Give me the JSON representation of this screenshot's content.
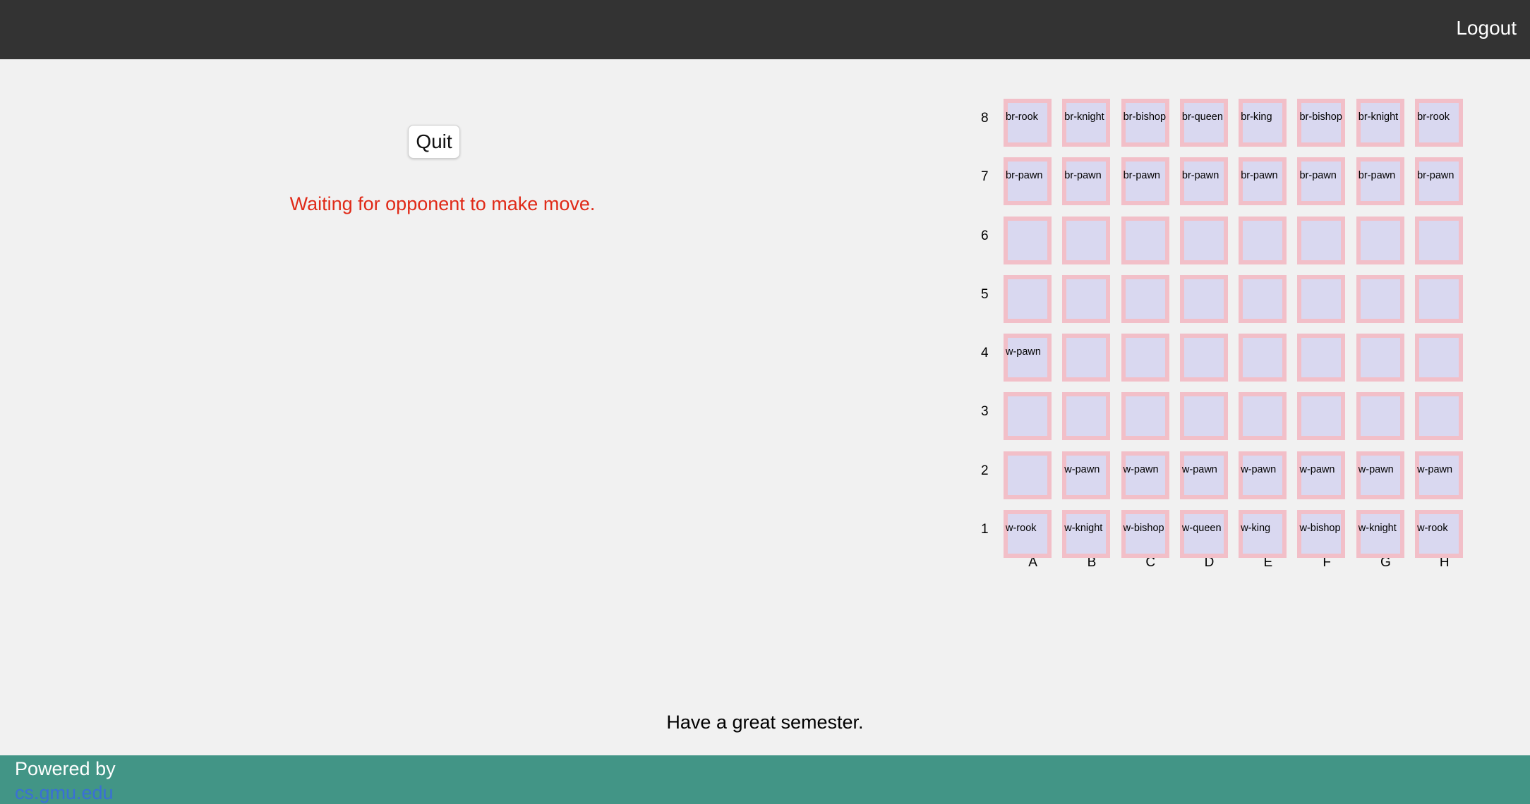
{
  "header": {
    "logout_label": "Logout"
  },
  "game": {
    "quit_label": "Quit",
    "status_text": "Waiting for opponent to make move."
  },
  "board": {
    "files": [
      "A",
      "B",
      "C",
      "D",
      "E",
      "F",
      "G",
      "H"
    ],
    "rows": [
      {
        "rank": "8",
        "squares": [
          "br-rook",
          "br-knight",
          "br-bishop",
          "br-queen",
          "br-king",
          "br-bishop",
          "br-knight",
          "br-rook"
        ]
      },
      {
        "rank": "7",
        "squares": [
          "br-pawn",
          "br-pawn",
          "br-pawn",
          "br-pawn",
          "br-pawn",
          "br-pawn",
          "br-pawn",
          "br-pawn"
        ]
      },
      {
        "rank": "6",
        "squares": [
          "",
          "",
          "",
          "",
          "",
          "",
          "",
          ""
        ]
      },
      {
        "rank": "5",
        "squares": [
          "",
          "",
          "",
          "",
          "",
          "",
          "",
          ""
        ]
      },
      {
        "rank": "4",
        "squares": [
          "w-pawn",
          "",
          "",
          "",
          "",
          "",
          "",
          ""
        ]
      },
      {
        "rank": "3",
        "squares": [
          "",
          "",
          "",
          "",
          "",
          "",
          "",
          ""
        ]
      },
      {
        "rank": "2",
        "squares": [
          "",
          "w-pawn",
          "w-pawn",
          "w-pawn",
          "w-pawn",
          "w-pawn",
          "w-pawn",
          "w-pawn"
        ]
      },
      {
        "rank": "1",
        "squares": [
          "w-rook",
          "w-knight",
          "w-bishop",
          "w-queen",
          "w-king",
          "w-bishop",
          "w-knight",
          "w-rook"
        ]
      }
    ],
    "colors": {
      "square_fill": "#d9d8f0",
      "square_border": "#f2bfc8"
    }
  },
  "message": {
    "text": "Have a great semester."
  },
  "footer": {
    "powered_by": "Powered by",
    "link_text": "cs.gmu.edu"
  },
  "colors": {
    "topbar": "#333333",
    "footer": "#429586",
    "status": "#e02a18",
    "link": "#3a6fd6"
  }
}
